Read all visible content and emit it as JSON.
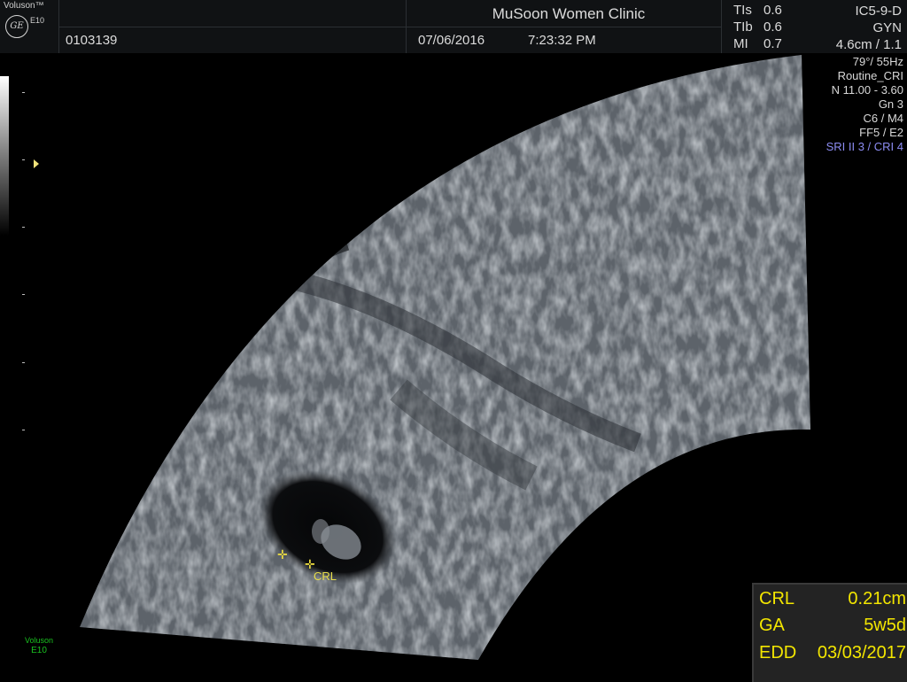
{
  "header": {
    "brand": "Voluson™",
    "model_small": "E10",
    "logo_text": "GE",
    "patient_id": "0103139",
    "clinic": "MuSoon Women Clinic",
    "date": "07/06/2016",
    "time": "7:23:32 PM"
  },
  "indices": [
    {
      "label": "TIs",
      "value": "0.6"
    },
    {
      "label": "TIb",
      "value": "0.6"
    },
    {
      "label": "MI",
      "value": "0.7"
    }
  ],
  "probe": {
    "name": "IC5-9-D",
    "app": "GYN",
    "depth": "4.6cm / 1.1"
  },
  "parameters": [
    "79°/ 55Hz",
    "Routine_CRI",
    "N 11.00 - 3.60",
    "Gn  3",
    "C6 / M4",
    "FF5 / E2"
  ],
  "sri": "SRI II 3 / CRI 4",
  "measurement": {
    "rows": [
      {
        "label": "CRL",
        "value": "0.21cm"
      },
      {
        "label": "GA",
        "value": "5w5d"
      },
      {
        "label": "EDD",
        "value": "03/03/2017"
      }
    ]
  },
  "annotation": {
    "crl_label": "CRL",
    "caliper_glyph": "✛"
  },
  "footer": {
    "brand": "Voluson",
    "model": "E10"
  },
  "colors": {
    "measurement_text": "#f3e600",
    "sri_text": "#8c8cf2",
    "footer_logo": "#19c21f"
  }
}
